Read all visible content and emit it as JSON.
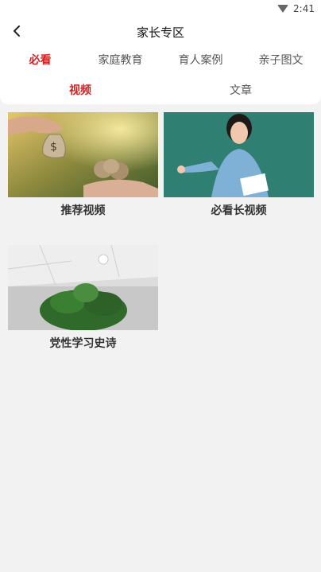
{
  "status": {
    "time": "2:41",
    "wifi_icon": "wifi-icon"
  },
  "header": {
    "title": "家长专区",
    "back_icon": "back-arrow-icon"
  },
  "tabs": [
    {
      "label": "必看",
      "active": true
    },
    {
      "label": "家庭教育",
      "active": false
    },
    {
      "label": "育人案例",
      "active": false
    },
    {
      "label": "亲子图文",
      "active": false
    }
  ],
  "subtabs": [
    {
      "label": "视频",
      "active": true
    },
    {
      "label": "文章",
      "active": false
    }
  ],
  "cards": [
    {
      "caption": "推荐视频"
    },
    {
      "caption": "必看长视频"
    },
    {
      "caption": "党性学习史诗"
    }
  ],
  "colors": {
    "accent": "#d21f1f",
    "background": "#f2f2f2"
  }
}
